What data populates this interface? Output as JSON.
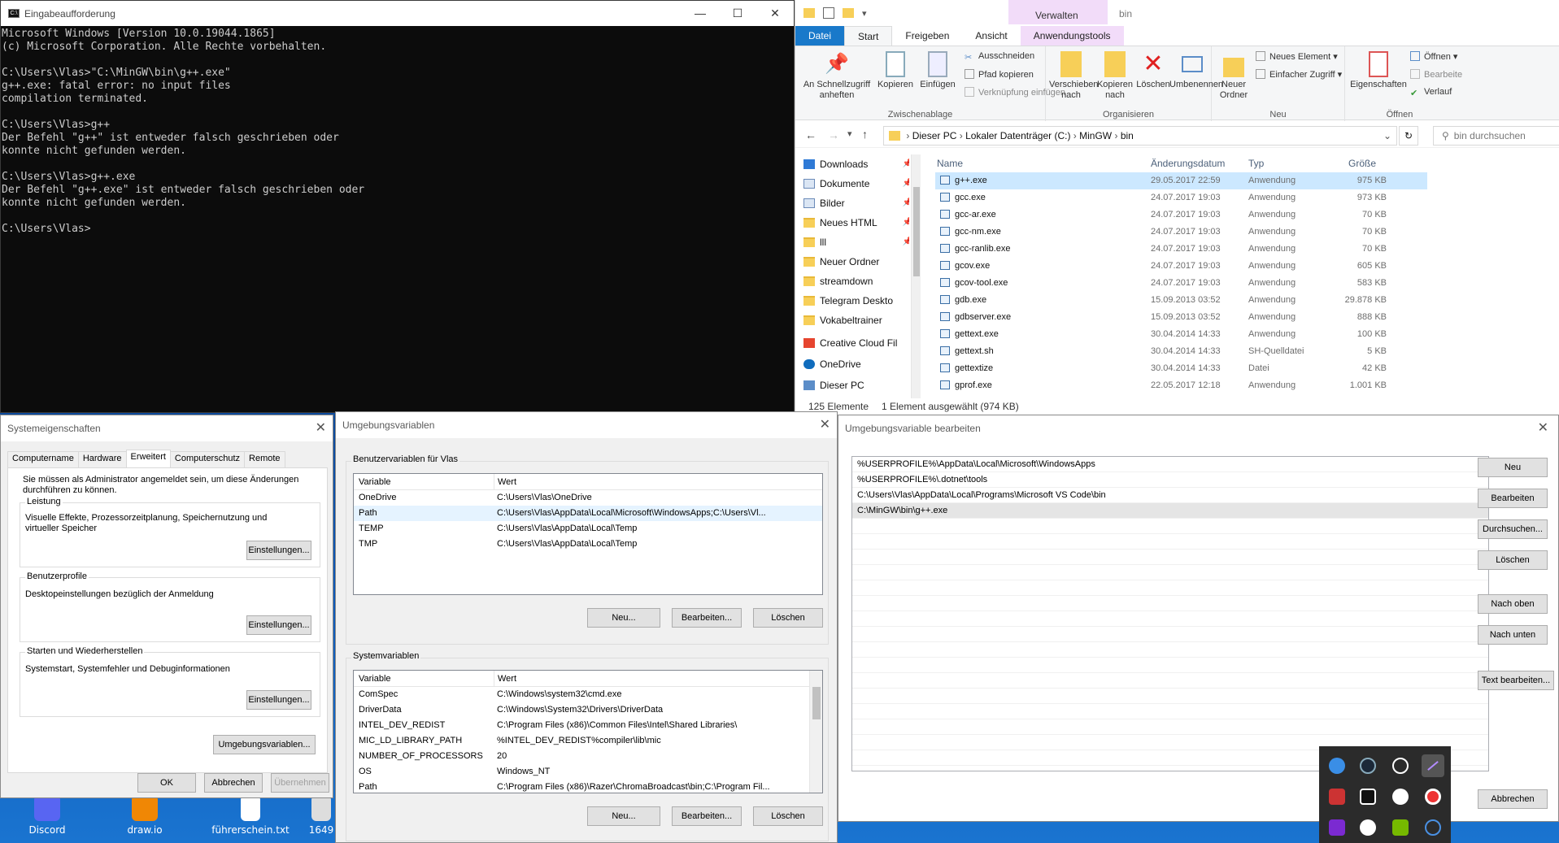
{
  "colors": {
    "accent": "#1979ca",
    "console_bg": "#0c0c0c",
    "console_text": "#cccccc",
    "selection": "#cce8ff",
    "desktop": "#0c58b8"
  },
  "desktop": {
    "icons": [
      "Discord",
      "draw.io",
      "führerschein.txt",
      "1649"
    ]
  },
  "cmd": {
    "title": "Eingabeaufforderung",
    "controls": {
      "minimize": "—",
      "maximize": "☐",
      "close": "✕"
    },
    "lines": [
      "Microsoft Windows [Version 10.0.19044.1865]",
      "(c) Microsoft Corporation. Alle Rechte vorbehalten.",
      "",
      "C:\\Users\\Vlas>\"C:\\MinGW\\bin\\g++.exe\"",
      "g++.exe: fatal error: no input files",
      "compilation terminated.",
      "",
      "C:\\Users\\Vlas>g++",
      "Der Befehl \"g++\" ist entweder falsch geschrieben oder",
      "konnte nicht gefunden werden.",
      "",
      "C:\\Users\\Vlas>g++.exe",
      "Der Befehl \"g++.exe\" ist entweder falsch geschrieben oder",
      "konnte nicht gefunden werden.",
      "",
      "C:\\Users\\Vlas>"
    ]
  },
  "explorer": {
    "window_title": "bin",
    "contextual_tab": "Verwalten",
    "tabs": [
      "Datei",
      "Start",
      "Freigeben",
      "Ansicht",
      "Anwendungstools"
    ],
    "ribbon": {
      "pin": "An Schnellzugriff anheften",
      "copy": "Kopieren",
      "paste": "Einfügen",
      "cut": "Ausschneiden",
      "copy_path": "Pfad kopieren",
      "paste_shortcut": "Verknüpfung einfügen",
      "group_clipboard": "Zwischenablage",
      "move_to": "Verschieben nach",
      "copy_to": "Kopieren nach",
      "delete": "Löschen",
      "rename": "Umbenennen",
      "group_organize": "Organisieren",
      "new_folder": "Neuer Ordner",
      "new_item": "Neues Element",
      "easy_access": "Einfacher Zugriff",
      "group_new": "Neu",
      "properties": "Eigenschaften",
      "open": "Öffnen",
      "edit": "Bearbeite",
      "history": "Verlauf",
      "group_open": "Öffnen"
    },
    "breadcrumb": [
      "Dieser PC",
      "Lokaler Datenträger (C:)",
      "MinGW",
      "bin"
    ],
    "search_placeholder": "bin durchsuchen",
    "nav": [
      "Downloads",
      "Dokumente",
      "Bilder",
      "Neues HTML",
      "lll",
      "Neuer Ordner",
      "streamdown",
      "Telegram Deskto",
      "Vokabeltrainer",
      "Creative Cloud Fil",
      "OneDrive",
      "Dieser PC"
    ],
    "columns": {
      "name": "Name",
      "date": "Änderungsdatum",
      "type": "Typ",
      "size": "Größe"
    },
    "files": [
      {
        "name": "g++.exe",
        "date": "29.05.2017 22:59",
        "type": "Anwendung",
        "size": "975 KB"
      },
      {
        "name": "gcc.exe",
        "date": "24.07.2017 19:03",
        "type": "Anwendung",
        "size": "973 KB"
      },
      {
        "name": "gcc-ar.exe",
        "date": "24.07.2017 19:03",
        "type": "Anwendung",
        "size": "70 KB"
      },
      {
        "name": "gcc-nm.exe",
        "date": "24.07.2017 19:03",
        "type": "Anwendung",
        "size": "70 KB"
      },
      {
        "name": "gcc-ranlib.exe",
        "date": "24.07.2017 19:03",
        "type": "Anwendung",
        "size": "70 KB"
      },
      {
        "name": "gcov.exe",
        "date": "24.07.2017 19:03",
        "type": "Anwendung",
        "size": "605 KB"
      },
      {
        "name": "gcov-tool.exe",
        "date": "24.07.2017 19:03",
        "type": "Anwendung",
        "size": "583 KB"
      },
      {
        "name": "gdb.exe",
        "date": "15.09.2013 03:52",
        "type": "Anwendung",
        "size": "29.878 KB"
      },
      {
        "name": "gdbserver.exe",
        "date": "15.09.2013 03:52",
        "type": "Anwendung",
        "size": "888 KB"
      },
      {
        "name": "gettext.exe",
        "date": "30.04.2014 14:33",
        "type": "Anwendung",
        "size": "100 KB"
      },
      {
        "name": "gettext.sh",
        "date": "30.04.2014 14:33",
        "type": "SH-Quelldatei",
        "size": "5 KB"
      },
      {
        "name": "gettextize",
        "date": "30.04.2014 14:33",
        "type": "Datei",
        "size": "42 KB"
      },
      {
        "name": "gprof.exe",
        "date": "22.05.2017 12:18",
        "type": "Anwendung",
        "size": "1.001 KB"
      }
    ],
    "status_count": "125 Elemente",
    "status_selected": "1 Element ausgewählt (974 KB)"
  },
  "sysprops": {
    "title": "Systemeigenschaften",
    "tabs": [
      "Computername",
      "Hardware",
      "Erweitert",
      "Computerschutz",
      "Remote"
    ],
    "admin_note": "Sie müssen als Administrator angemeldet sein, um diese Änderungen durchführen zu können.",
    "perf_title": "Leistung",
    "perf_text": "Visuelle Effekte, Prozessorzeitplanung, Speichernutzung und virtueller Speicher",
    "profiles_title": "Benutzerprofile",
    "profiles_text": "Desktopeinstellungen bezüglich der Anmeldung",
    "startup_title": "Starten und Wiederherstellen",
    "startup_text": "Systemstart, Systemfehler und Debuginformationen",
    "settings_btn": "Einstellungen...",
    "env_btn": "Umgebungsvariablen...",
    "ok": "OK",
    "cancel": "Abbrechen",
    "apply": "Übernehmen"
  },
  "envvars": {
    "title": "Umgebungsvariablen",
    "user_group": "Benutzervariablen für Vlas",
    "system_group": "Systemvariablen",
    "col_var": "Variable",
    "col_val": "Wert",
    "user_vars": [
      {
        "name": "OneDrive",
        "value": "C:\\Users\\Vlas\\OneDrive"
      },
      {
        "name": "Path",
        "value": "C:\\Users\\Vlas\\AppData\\Local\\Microsoft\\WindowsApps;C:\\Users\\Vl..."
      },
      {
        "name": "TEMP",
        "value": "C:\\Users\\Vlas\\AppData\\Local\\Temp"
      },
      {
        "name": "TMP",
        "value": "C:\\Users\\Vlas\\AppData\\Local\\Temp"
      }
    ],
    "system_vars": [
      {
        "name": "ComSpec",
        "value": "C:\\Windows\\system32\\cmd.exe"
      },
      {
        "name": "DriverData",
        "value": "C:\\Windows\\System32\\Drivers\\DriverData"
      },
      {
        "name": "INTEL_DEV_REDIST",
        "value": "C:\\Program Files (x86)\\Common Files\\Intel\\Shared Libraries\\"
      },
      {
        "name": "MIC_LD_LIBRARY_PATH",
        "value": "%INTEL_DEV_REDIST%compiler\\lib\\mic"
      },
      {
        "name": "NUMBER_OF_PROCESSORS",
        "value": "20"
      },
      {
        "name": "OS",
        "value": "Windows_NT"
      },
      {
        "name": "Path",
        "value": "C:\\Program Files (x86)\\Razer\\ChromaBroadcast\\bin;C:\\Program Fil..."
      }
    ],
    "new": "Neu...",
    "edit": "Bearbeiten...",
    "delete": "Löschen"
  },
  "editenv": {
    "title": "Umgebungsvariable bearbeiten",
    "entries": [
      "%USERPROFILE%\\AppData\\Local\\Microsoft\\WindowsApps",
      "%USERPROFILE%\\.dotnet\\tools",
      "C:\\Users\\Vlas\\AppData\\Local\\Programs\\Microsoft VS Code\\bin",
      "C:\\MinGW\\bin\\g++.exe"
    ],
    "btn_new": "Neu",
    "btn_edit": "Bearbeiten",
    "btn_browse": "Durchsuchen...",
    "btn_delete": "Löschen",
    "btn_up": "Nach oben",
    "btn_down": "Nach unten",
    "btn_text": "Text bearbeiten...",
    "btn_cancel": "Abbrechen"
  },
  "tray": {
    "icons": [
      "edge-icon",
      "steam-icon",
      "shield-icon",
      "brush-icon",
      "flag-icon",
      "app-icon",
      "g-icon",
      "chrome-icon",
      "onenote-icon",
      "discord-icon",
      "nvidia-icon",
      "circle-icon"
    ]
  }
}
